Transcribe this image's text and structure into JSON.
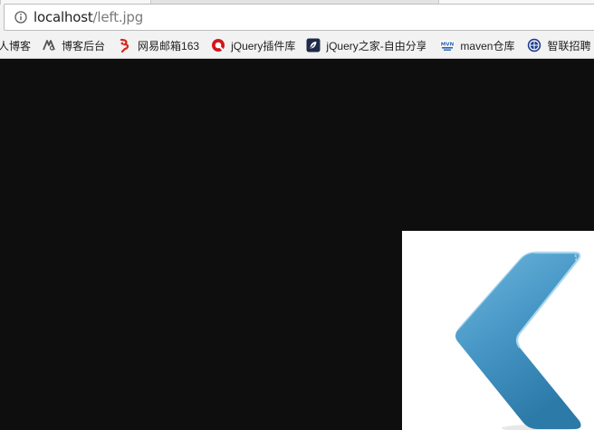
{
  "address_bar": {
    "host": "localhost",
    "path": "/left.jpg"
  },
  "bookmarks": [
    {
      "label": "人博客",
      "icon": "blog-icon"
    },
    {
      "label": "博客后台",
      "icon": "blog-admin-icon"
    },
    {
      "label": "网易邮箱163",
      "icon": "netease-mail-icon"
    },
    {
      "label": "jQuery插件库",
      "icon": "jquery-plugin-icon"
    },
    {
      "label": "jQuery之家-自由分享",
      "icon": "jquery-home-icon"
    },
    {
      "label": "maven仓库",
      "icon": "maven-icon"
    },
    {
      "label": "智联招聘",
      "icon": "zhaopin-icon"
    }
  ],
  "colors": {
    "page_background": "#0e0e0e",
    "arrow_light": "#6cb4dc",
    "arrow_dark": "#2f7fae"
  }
}
